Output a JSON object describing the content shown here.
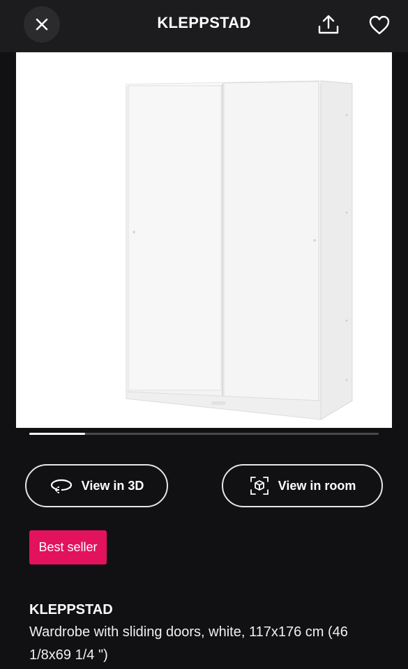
{
  "header": {
    "title": "KLEPPSTAD",
    "close_icon": "close-icon",
    "share_icon": "share-icon",
    "favorite_icon": "heart-icon"
  },
  "gallery": {
    "image_subject": "white wardrobe with two sliding doors",
    "progress": 0.16
  },
  "actions": {
    "view_3d_label": "View in 3D",
    "view_3d_icon": "rotate-3d-icon",
    "view_room_label": "View in room",
    "view_room_icon": "ar-cube-icon"
  },
  "badge": {
    "label": "Best seller",
    "color": "#e2125d"
  },
  "product": {
    "name": "KLEPPSTAD",
    "description": "Wardrobe with sliding doors, white, 117x176 cm (46 1/8x69 1/4 \")"
  }
}
